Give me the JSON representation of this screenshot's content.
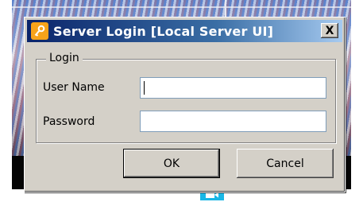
{
  "dialog": {
    "title": "Server Login [Local Server UI]",
    "close_label": "X",
    "group_label": "Login",
    "username_label": "User Name",
    "username_value": "",
    "password_label": "Password",
    "password_value": "",
    "ok_label": "OK",
    "cancel_label": "Cancel"
  },
  "colors": {
    "title_bar_start": "#0a246a",
    "title_bar_end": "#a6caf0",
    "dialog_face": "#d4d0c8",
    "key_icon": "#f7a31a",
    "camera_button": "#19b7e6"
  },
  "icons": {
    "title": "key-icon",
    "taskbar": "video-camera-icon"
  }
}
